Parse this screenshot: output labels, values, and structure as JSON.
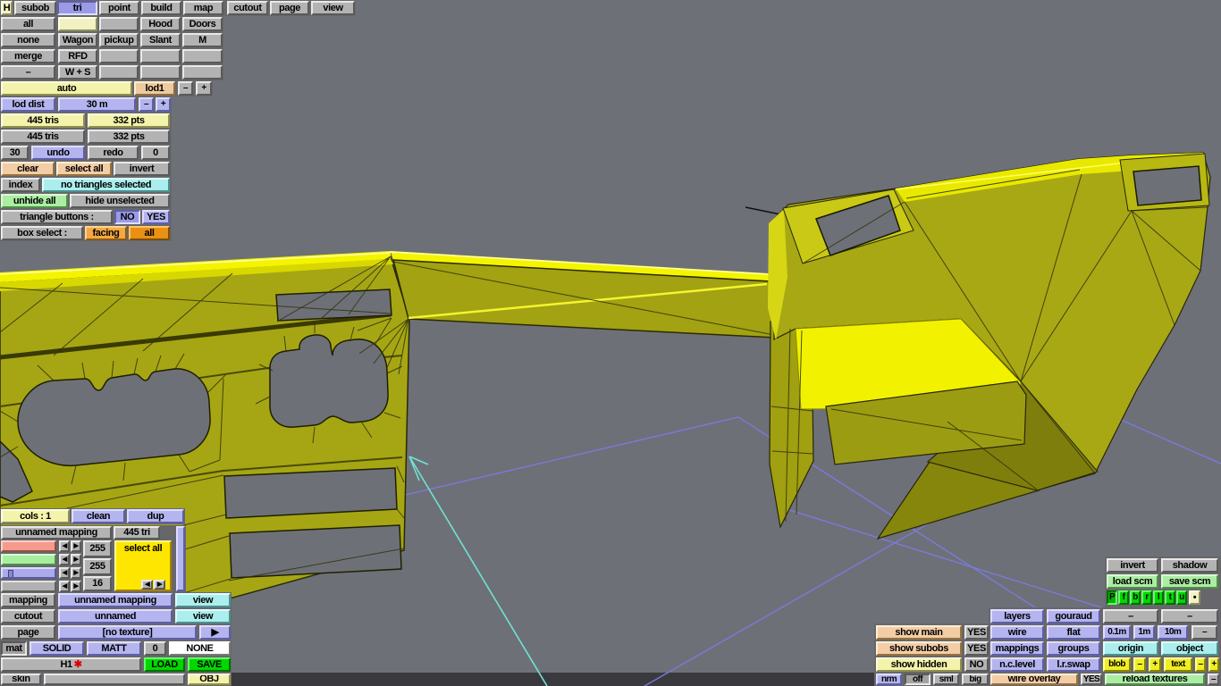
{
  "colors": {
    "model_yellow": "#a8a815",
    "highlight_yellow": "#f2f200",
    "grid_blue": "#7b7bdf",
    "marker_cyan": "#70e2d2",
    "selected_rgb": "255,255,16"
  },
  "tabs": [
    "H",
    "subob",
    "tri",
    "point",
    "build",
    "map",
    "cutout",
    "page",
    "view"
  ],
  "grid": [
    [
      "all",
      "",
      "",
      "Hood",
      "Doors"
    ],
    [
      "none",
      "Wagon",
      "pickup",
      "Slant",
      "M"
    ],
    [
      "merge",
      "RFD",
      "",
      "",
      ""
    ],
    [
      "–",
      "W + S",
      "",
      "",
      ""
    ]
  ],
  "lod": {
    "auto": "auto",
    "lod1": "lod1",
    "minus": "–",
    "plus": "+",
    "dist_label": "lod dist",
    "dist_value": "30 m"
  },
  "stats": {
    "tris": "445 tris",
    "pts": "332 pts",
    "undo_count": "30",
    "undo": "undo",
    "redo": "redo",
    "redo_count": "0"
  },
  "sel": {
    "clear": "clear",
    "select_all": "select all",
    "invert": "invert",
    "index": "index",
    "status": "no triangles selected",
    "unhide": "unhide all",
    "hide": "hide unselected",
    "tb_label": "triangle buttons :",
    "no": "NO",
    "yes": "YES",
    "bs_label": "box select :",
    "facing": "facing",
    "all": "all"
  },
  "cp": {
    "cols": "cols : 1",
    "clean": "clean",
    "dup": "dup",
    "name": "unnamed mapping",
    "count": "445 tri",
    "r": "255",
    "g": "255",
    "b": "16",
    "swatch": "select all",
    "al": "◄",
    "ar": "►"
  },
  "mp": {
    "mapping": "mapping",
    "mapping_v": "unnamed mapping",
    "view": "view",
    "cutout": "cutout",
    "cutout_v": "unnamed",
    "page": "page",
    "page_v": "[no texture]",
    "arrow": "▶",
    "mat": "mat",
    "solid": "SOLID",
    "matt": "MATT",
    "num": "0",
    "none": "NONE",
    "h1": "H1",
    "star": "✱",
    "load": "LOAD",
    "save": "SAVE",
    "skin": "skin",
    "obj": "OBJ"
  },
  "rp": {
    "invert": "invert",
    "shadow": "shadow",
    "load_scm": "load scm",
    "save_scm": "save scm",
    "proj": [
      "P",
      "f",
      "b",
      "r",
      "l",
      "t",
      "u",
      "•"
    ],
    "layers": "layers",
    "gouraud": "gouraud",
    "dash": "–",
    "show_main": "show main",
    "yes1": "YES",
    "wire": "wire",
    "flat": "flat",
    "m01": "0.1m",
    "m1": "1m",
    "m10": "10m",
    "show_subobs": "show subobs",
    "yes2": "YES",
    "mappings": "mappings",
    "groups": "groups",
    "origin": "origin",
    "object": "object",
    "show_hidden": "show hidden",
    "no": "NO",
    "nclevel": "n.c.level",
    "lrswap": "l.r.swap",
    "blob": "blob",
    "minus": "–",
    "plus": "+",
    "text": "text",
    "nrm": "nrm",
    "off": "off",
    "sml": "sml",
    "big": "big",
    "wire_overlay": "wire overlay",
    "yes3": "YES",
    "reload": "reload textures"
  }
}
